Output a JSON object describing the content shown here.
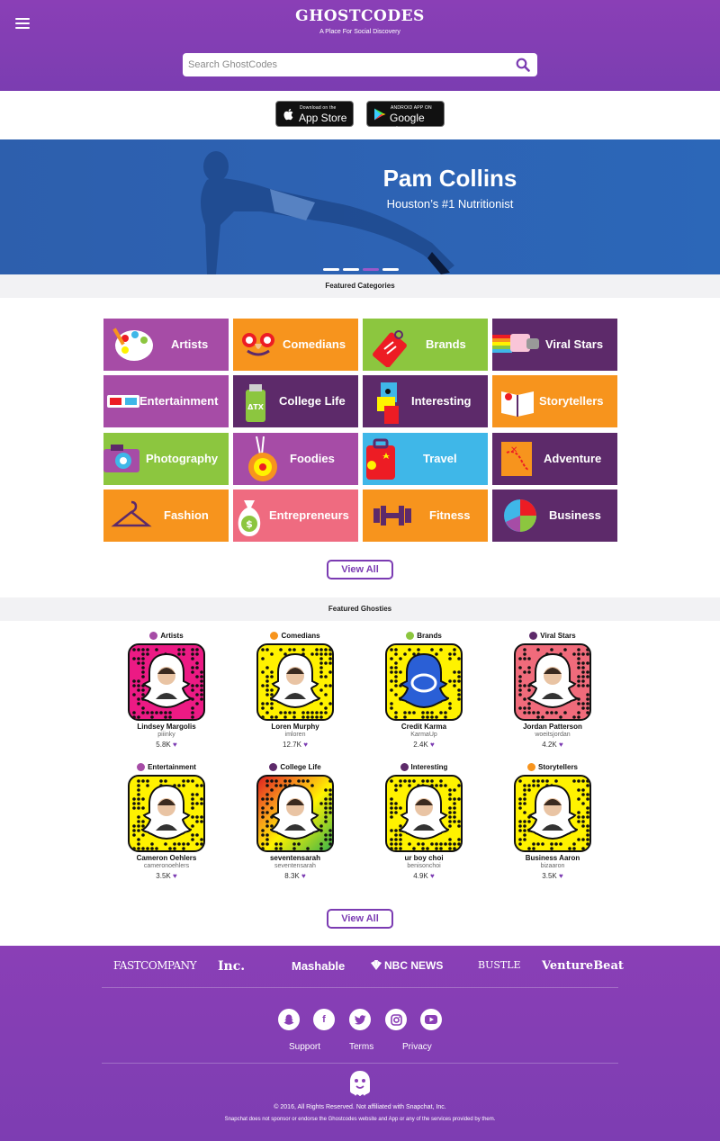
{
  "header": {
    "logo": "GHOSTCODES",
    "tagline": "A Place For Social Discovery",
    "search_placeholder": "Search GhostCodes"
  },
  "app_badges": {
    "app_store_small": "Download on the",
    "app_store_big": "App Store",
    "google_small": "ANDROID APP ON",
    "google_big": "Google play"
  },
  "hero": {
    "name": "Pam Collins",
    "subtitle": "Houston’s #1 Nutritionist",
    "slides": 4,
    "active_slide": 3
  },
  "featured_categories": {
    "heading": "Featured Categories",
    "items": [
      {
        "label": "Artists",
        "color": "#a64ca6"
      },
      {
        "label": "Comedians",
        "color": "#f7941d"
      },
      {
        "label": "Brands",
        "color": "#8cc63f"
      },
      {
        "label": "Viral Stars",
        "color": "#5d2a6a"
      },
      {
        "label": "Entertainment",
        "color": "#a64ca6"
      },
      {
        "label": "College Life",
        "color": "#5d2a6a"
      },
      {
        "label": "Interesting",
        "color": "#5d2a6a"
      },
      {
        "label": "Storytellers",
        "color": "#f7941d"
      },
      {
        "label": "Photography",
        "color": "#8cc63f"
      },
      {
        "label": "Foodies",
        "color": "#a64ca6"
      },
      {
        "label": "Travel",
        "color": "#3fb7e8"
      },
      {
        "label": "Adventure",
        "color": "#5d2a6a"
      },
      {
        "label": "Fashion",
        "color": "#f7941d"
      },
      {
        "label": "Entrepreneurs",
        "color": "#ef6b80"
      },
      {
        "label": "Fitness",
        "color": "#f7941d"
      },
      {
        "label": "Business",
        "color": "#5d2a6a"
      }
    ],
    "view_all": "View All"
  },
  "featured_ghosties": {
    "heading": "Featured Ghosties",
    "items": [
      {
        "category": "Artists",
        "name": "Lindsey Margolis",
        "username": "piiinky",
        "count": "5.8K",
        "code_color": "#ec1a84",
        "dot_color": "#a64ca6"
      },
      {
        "category": "Comedians",
        "name": "Loren Murphy",
        "username": "imloren",
        "count": "12.7K",
        "code_color": "#fff200",
        "dot_color": "#f7941d"
      },
      {
        "category": "Brands",
        "name": "Credit Karma",
        "username": "KarmaUp",
        "count": "2.4K",
        "code_color": "#fff200",
        "dot_color": "#8cc63f"
      },
      {
        "category": "Viral Stars",
        "name": "Jordan Patterson",
        "username": "woeitsjordan",
        "count": "4.2K",
        "code_color": "#f06b7b",
        "dot_color": "#5d2a6a"
      },
      {
        "category": "Entertainment",
        "name": "Cameron Oehlers",
        "username": "cameronoehlers",
        "count": "3.5K",
        "code_color": "#fff200",
        "dot_color": "#a64ca6"
      },
      {
        "category": "College Life",
        "name": "seventensarah",
        "username": "seventensarah",
        "count": "8.3K",
        "code_color": "#e02020",
        "dot_color": "#5d2a6a"
      },
      {
        "category": "Interesting",
        "name": "ur boy choi",
        "username": "benisonchoi",
        "count": "4.9K",
        "code_color": "#fff200",
        "dot_color": "#5d2a6a"
      },
      {
        "category": "Storytellers",
        "name": "Business Aaron",
        "username": "bizaaron",
        "count": "3.5K",
        "code_color": "#fff200",
        "dot_color": "#f7941d"
      }
    ],
    "view_all": "View All"
  },
  "footer": {
    "press": [
      "FASTCOMPANY",
      "Inc.",
      "Mashable",
      "NBC NEWS",
      "BUSTLE",
      "VentureBeat"
    ],
    "social": [
      "snapchat-icon",
      "facebook-icon",
      "twitter-icon",
      "instagram-icon",
      "youtube-icon"
    ],
    "links": [
      "Support",
      "Terms",
      "Privacy"
    ],
    "copyright": "© 2016, All Rights Reserved. Not affiliated with Snapchat, Inc.",
    "disclaimer": "Snapchat does not sponsor or endorse the Ghostcodes website and App or any of the services provided by them."
  },
  "colors": {
    "brand_purple": "#7b3bb2",
    "hero_blue": "#2d63b4"
  }
}
